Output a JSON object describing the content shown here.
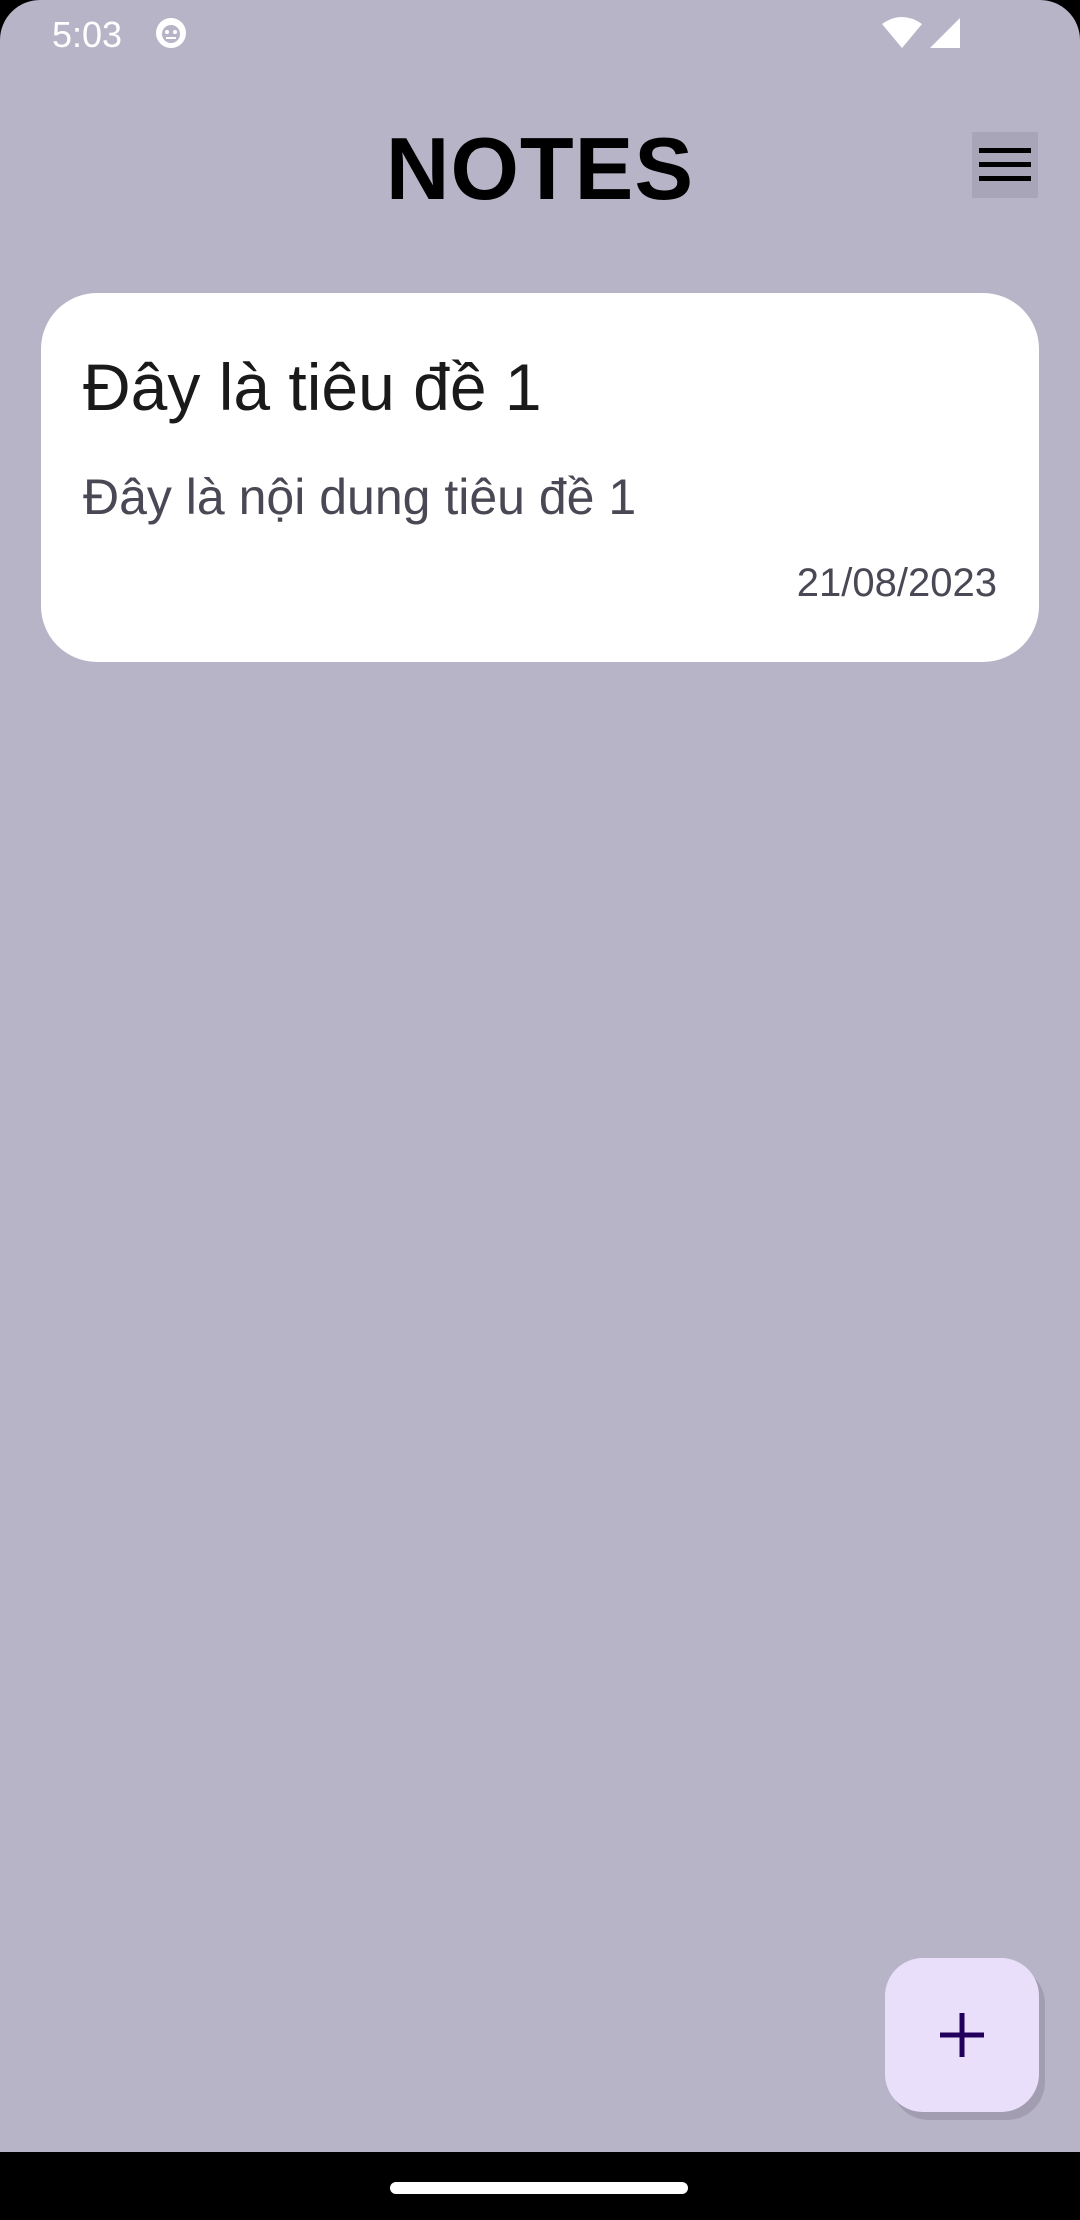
{
  "status_bar": {
    "time": "5:03",
    "icons": [
      "app-notification-icon",
      "wifi-icon",
      "signal-icon"
    ]
  },
  "header": {
    "title": "NOTES",
    "menu_icon": "hamburger-menu-icon"
  },
  "notes": [
    {
      "title": "Đây là tiêu đề 1",
      "content": "Đây là nội dung tiêu đề 1",
      "date": "21/08/2023"
    }
  ],
  "fab": {
    "icon": "plus-icon"
  },
  "colors": {
    "background": "#b8b4c8",
    "card": "#ffffff",
    "fab": "#eadffb",
    "fab_icon": "#21005d"
  }
}
